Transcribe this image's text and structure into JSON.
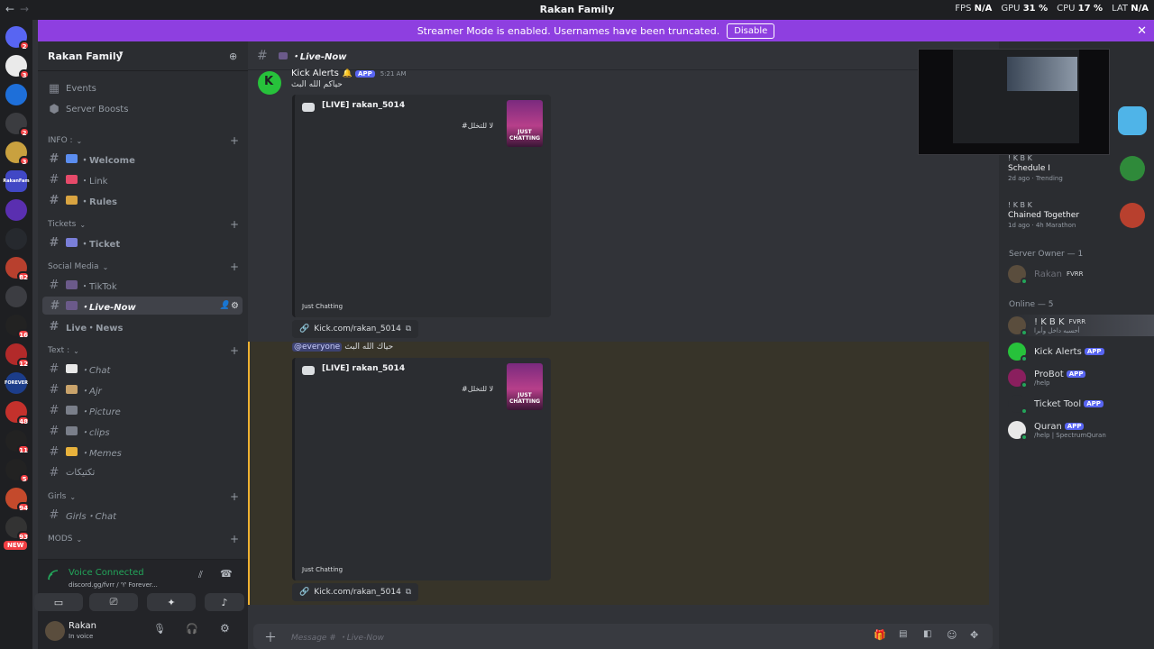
{
  "window": {
    "title": "Rakan Family",
    "stats": [
      {
        "label": "FPS",
        "value": "N/A"
      },
      {
        "label": "GPU",
        "value": "31 %"
      },
      {
        "label": "CPU",
        "value": "17 %"
      },
      {
        "label": "LAT",
        "value": "N/A"
      }
    ]
  },
  "banner": {
    "text": "Streamer Mode is enabled. Usernames have been truncated.",
    "disable_label": "Disable",
    "color": "#8e3fe0"
  },
  "guilds": [
    {
      "badge": "2",
      "color": "#5865f2",
      "label": ""
    },
    {
      "badge": "3",
      "color": "#eaeaea",
      "label": ""
    },
    {
      "badge": "",
      "color": "#1e6fd9",
      "label": ""
    },
    {
      "badge": "2",
      "color": "#3b3c40",
      "label": ""
    },
    {
      "badge": "3",
      "color": "#c9a13f",
      "label": ""
    },
    {
      "badge": "",
      "color": "#4148c5",
      "label": "RakanFam"
    },
    {
      "badge": "",
      "color": "#5a2fb0",
      "label": ""
    },
    {
      "badge": "",
      "color": "#26292e",
      "label": ""
    },
    {
      "badge": "82",
      "color": "#b8402e",
      "label": ""
    },
    {
      "badge": "",
      "color": "#3c3d42",
      "label": ""
    },
    {
      "badge": "16",
      "color": "#222",
      "label": ""
    },
    {
      "badge": "12",
      "color": "#b22a2a",
      "label": ""
    },
    {
      "badge": "",
      "color": "#1c3d8a",
      "label": "FOREVER"
    },
    {
      "badge": "48",
      "color": "#c4312c",
      "label": ""
    },
    {
      "badge": "11",
      "color": "#222",
      "label": ""
    },
    {
      "badge": "5",
      "color": "#222",
      "label": ""
    },
    {
      "badge": "94",
      "color": "#c44a2c",
      "label": ""
    },
    {
      "badge": "93",
      "color": "#333",
      "label": ""
    }
  ],
  "guild_new_badge": "NEW",
  "server": {
    "name": "Rakan Family",
    "top_items": [
      {
        "label": "Events"
      },
      {
        "label": "Server Boosts"
      }
    ],
    "categories": [
      {
        "name": "INFO :",
        "channels": [
          {
            "label": "・Welcome",
            "emoji_color": "#5b8def",
            "style": "bold"
          },
          {
            "label": "・Link",
            "emoji_color": "#e64a6a",
            "style": ""
          },
          {
            "label": "・Rules",
            "emoji_color": "#d9a441",
            "style": "bold"
          }
        ]
      },
      {
        "name": "Tickets",
        "channels": [
          {
            "label": "・Ticket",
            "emoji_color": "#7a7fd9",
            "style": "bold"
          }
        ]
      },
      {
        "name": "Social Media",
        "channels": [
          {
            "label": "・TikTok",
            "emoji_color": "#6b5a8a",
            "style": ""
          },
          {
            "label": "・Live-Now",
            "emoji_color": "#6b5a8a",
            "style": "active"
          },
          {
            "label": "Live・News",
            "emoji_color": "",
            "style": "bold"
          }
        ]
      },
      {
        "name": "Text :",
        "channels": [
          {
            "label": "・Chat",
            "emoji_color": "#e8e8e8",
            "style": "it"
          },
          {
            "label": "・Ajr",
            "emoji_color": "#c9a36b",
            "style": "it"
          },
          {
            "label": "・Picture",
            "emoji_color": "#7a7f8a",
            "style": "it"
          },
          {
            "label": "・clips",
            "emoji_color": "#7a7f8a",
            "style": "it"
          },
          {
            "label": "・Memes",
            "emoji_color": "#e8b23c",
            "style": "it"
          },
          {
            "label": "تكتيكات",
            "emoji_color": "",
            "style": ""
          }
        ]
      },
      {
        "name": "Girls",
        "channels": [
          {
            "label": "Girls・Chat",
            "emoji_color": "",
            "style": "it"
          }
        ]
      },
      {
        "name": "MODS",
        "channels": []
      }
    ]
  },
  "voice": {
    "status": "Voice Connected",
    "server": "discord.gg/fvrr / ♈ Forever..."
  },
  "user": {
    "name": "Rakan",
    "status": "In voice"
  },
  "channel": {
    "name": "・Live-Now",
    "input_placeholder": "Message # ・Live-Now"
  },
  "messages": [
    {
      "author": "Kick Alerts",
      "tag": "APP",
      "time": "5:21 AM",
      "text": "حياكم الله البث",
      "embed": {
        "title": "[LIVE] rakan_5014",
        "description": "#لا للتخلل",
        "thumb_text": "JUST CHATTING",
        "footer": "Just Chatting"
      },
      "link": "Kick.com/rakan_5014"
    },
    {
      "mention": "@everyone",
      "text": "حياك الله البث",
      "embed": {
        "title": "[LIVE] rakan_5014",
        "description": "#لا للتخلل",
        "thumb_text": "JUST CHATTING",
        "footer": "Just Chatting"
      },
      "link": "Kick.com/rakan_5014"
    }
  ],
  "members": {
    "activities": [
      {
        "name": "Schedule I",
        "user": "! K B K",
        "meta1": "2d ago",
        "meta2": "Trending",
        "color": "#2f8a3a"
      },
      {
        "name": "Chained Together",
        "user": "! K B K",
        "meta1": "1d ago",
        "meta2": "4h Marathon",
        "color": "#b8402e"
      }
    ],
    "owner_section": "Server Owner — 1",
    "owner": {
      "name": "Rakan",
      "tag": "FVRR"
    },
    "online_section": "Online — 5",
    "online": [
      {
        "name": "! K B K",
        "tag": "FVRR",
        "sub": "أحسبه داخل وأبرا",
        "tag_color": "",
        "color": "#5a4d3d"
      },
      {
        "name": "Kick Alerts",
        "tag": "APP",
        "sub": "",
        "tag_color": "#5865f2",
        "color": "#27c23b"
      },
      {
        "name": "ProBot",
        "tag": "APP",
        "sub": "/help",
        "tag_color": "#5865f2",
        "color": "#8a1f5e"
      },
      {
        "name": "Ticket Tool",
        "tag": "APP",
        "sub": "",
        "tag_color": "#5865f2",
        "color": "#2b2d31"
      },
      {
        "name": "Quran",
        "tag": "APP",
        "sub": "/help | SpectrumQuran",
        "tag_color": "#5865f2",
        "color": "#e8e8e8"
      }
    ]
  }
}
